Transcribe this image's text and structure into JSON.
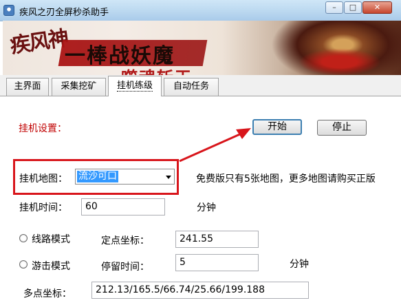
{
  "window": {
    "title": "疾风之刃全屏秒杀助手",
    "icon": "app-icon",
    "buttons": {
      "minimize": "–",
      "maximize": "□",
      "close": "✕"
    }
  },
  "banner": {
    "logo_text": "疾风神",
    "logo_sub": "",
    "slogan": "一棒战妖魔",
    "slogan2": "噬魂斩天"
  },
  "tabs": [
    {
      "label": "主界面",
      "active": false
    },
    {
      "label": "采集挖矿",
      "active": false
    },
    {
      "label": "挂机练级",
      "active": true
    },
    {
      "label": "自动任务",
      "active": false
    }
  ],
  "hang": {
    "section_title": "挂机设置：",
    "start_label": "开始",
    "stop_label": "停止",
    "map_label": "挂机地图：",
    "map_selected": "流沙可口",
    "map_note": "免费版只有5张地图，更多地图请购买正版",
    "time_label": "挂机时间：",
    "time_value": "60",
    "time_unit": "分钟",
    "route_mode_label": "线路模式",
    "fixed_coord_label": "定点坐标：",
    "fixed_coord_value": "241.55",
    "roam_mode_label": "游击模式",
    "stay_time_label": "停留时间：",
    "stay_time_value": "5",
    "stay_time_unit": "分钟",
    "multi_coord_label": "多点坐标：",
    "multi_coord_value": "212.13/165.5/66.74/25.66/199.188"
  },
  "annotation": {
    "color": "#d8151b"
  }
}
